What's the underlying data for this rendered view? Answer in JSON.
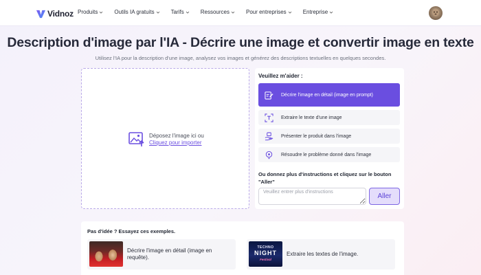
{
  "brand": {
    "name": "Vidnoz",
    "accent": "#6a4ee0"
  },
  "nav": {
    "items": [
      {
        "label": "Produits"
      },
      {
        "label": "Outils IA gratuits"
      },
      {
        "label": "Tarifs"
      },
      {
        "label": "Ressources"
      },
      {
        "label": "Pour entreprises"
      },
      {
        "label": "Entreprise"
      }
    ],
    "chevron_icon": "chevron-down-icon",
    "avatar_icon": "user-avatar"
  },
  "hero": {
    "title": "Description d'image par l'IA - Décrire une image et convertir image en texte",
    "subtitle": "Utilisez l'IA pour la description d'une image, analysez vos images et générez des descriptions textuelles en quelques secondes."
  },
  "upload": {
    "icon": "image-upload-icon",
    "drop_text": "Déposez l'image ici ou",
    "link_text": "Cliquez pour importer"
  },
  "panel": {
    "label": "Veuillez m'aider :",
    "options": [
      {
        "label": "Décrire l'image en détail (image en prompt)",
        "icon": "edit-document-icon",
        "active": true
      },
      {
        "label": "Extraire le texte d'une image",
        "icon": "text-scan-icon",
        "active": false
      },
      {
        "label": "Présenter le produit dans l'image",
        "icon": "product-hand-icon",
        "active": false
      },
      {
        "label": "Résoudre le problème donné dans l'image",
        "icon": "lightbulb-icon",
        "active": false
      }
    ],
    "instructions_label": "Ou donnez plus d'instructions et cliquez sur le bouton \"Aller\"",
    "instructions_placeholder": "Veuillez entrer plus d'instructions",
    "instructions_value": "",
    "go_button": "Aller"
  },
  "examples": {
    "title": "Pas d'idée ? Essayez ces exemples.",
    "cards": [
      {
        "text": "Décrire l'image en détail (image en requête).",
        "thumb": "football-players-photo"
      },
      {
        "text": "Extraire les textes de l'image.",
        "thumb": "techno-night-poster",
        "thumb_lines": [
          "TECHNO",
          "NIGHT",
          "Festival"
        ]
      }
    ]
  }
}
